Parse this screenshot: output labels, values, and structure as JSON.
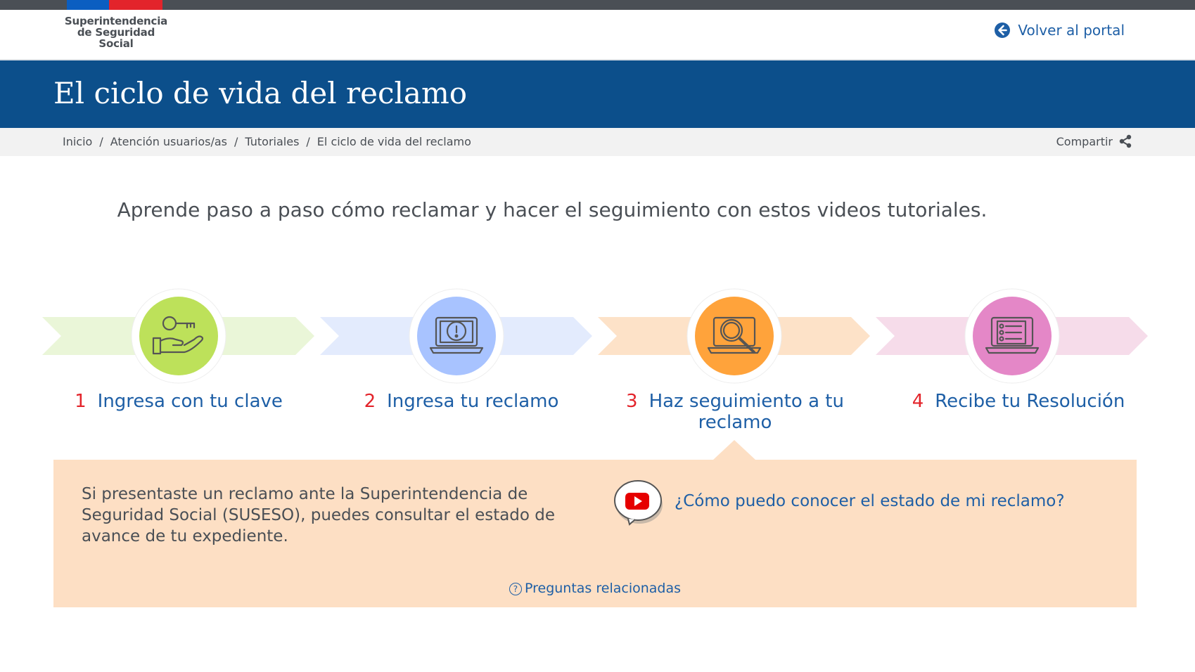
{
  "header": {
    "logo_line1": "Superintendencia",
    "logo_line2": "de Seguridad",
    "logo_line3": "Social",
    "back_label": "Volver al portal"
  },
  "hero": {
    "title": "El ciclo de vida del reclamo"
  },
  "breadcrumb": {
    "items": [
      "Inicio",
      "Atención usuarios/as",
      "Tutoriales",
      "El ciclo de vida del reclamo"
    ],
    "share_label": "Compartir"
  },
  "intro": "Aprende paso a paso cómo reclamar y hacer el seguimiento con estos videos tutoriales.",
  "steps": [
    {
      "number": "1",
      "label": "Ingresa con tu clave",
      "icon": "key-hand-icon",
      "color": "#bde15a",
      "band": "#eaf6d8"
    },
    {
      "number": "2",
      "label": "Ingresa tu reclamo",
      "icon": "laptop-alert-icon",
      "color": "#a8c3ff",
      "band": "#e3ebfd"
    },
    {
      "number": "3",
      "label": "Haz seguimiento a tu reclamo",
      "icon": "laptop-search-icon",
      "color": "#ffa33b",
      "band": "#fde2c8"
    },
    {
      "number": "4",
      "label": "Recibe tu Resolución",
      "icon": "laptop-checklist-icon",
      "color": "#e487c7",
      "band": "#f6dcea"
    }
  ],
  "panel": {
    "text": "Si presentaste un reclamo ante la Superintendencia de Seguridad Social (SUSESO), puedes consultar el estado de avance de tu expediente.",
    "video_link": "¿Cómo puedo conocer el estado de mi reclamo?",
    "faq_link": "Preguntas relacionadas"
  }
}
